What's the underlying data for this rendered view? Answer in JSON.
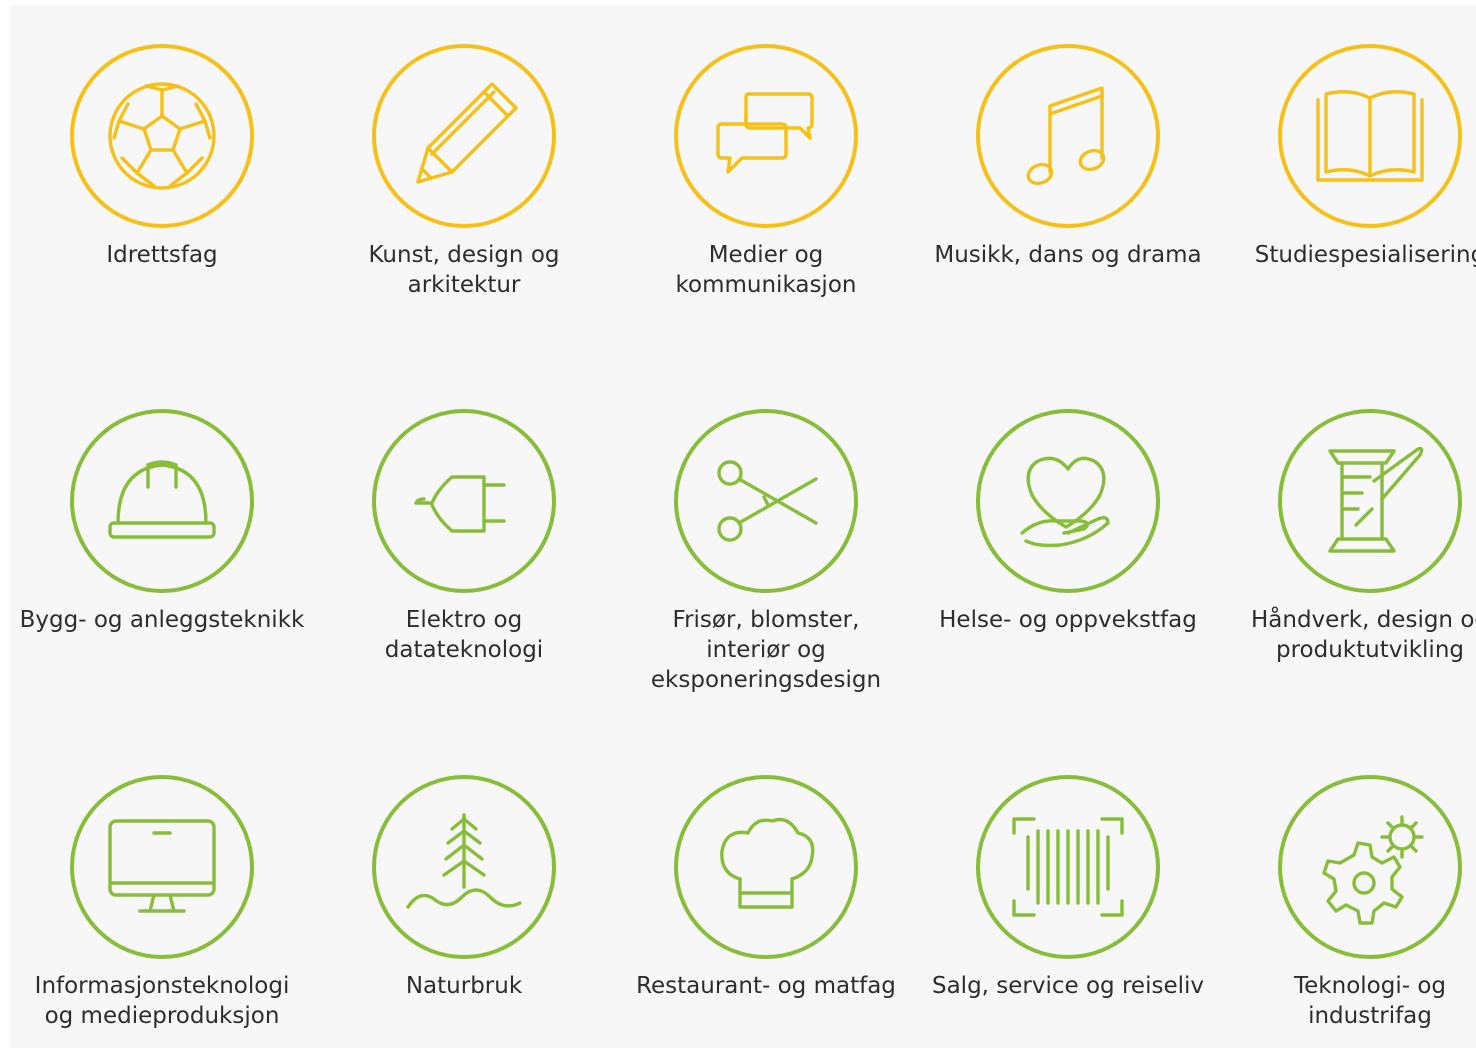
{
  "colors": {
    "row1_accent": "#f5c018",
    "rows23_accent": "#88bd3a",
    "label_text": "#2d2d2d",
    "background": "#f7f7f7"
  },
  "programs": [
    {
      "label": "Idrettsfag",
      "icon": "football-icon"
    },
    {
      "label": "Kunst, design og\narkitektur",
      "icon": "pencil-icon"
    },
    {
      "label": "Medier og\nkommunikasjon",
      "icon": "speech-bubbles-icon"
    },
    {
      "label": "Musikk, dans og drama",
      "icon": "music-note-icon"
    },
    {
      "label": "Studiespesialisering",
      "icon": "open-book-icon"
    },
    {
      "label": "Bygg- og anleggsteknikk",
      "icon": "hard-hat-icon"
    },
    {
      "label": "Elektro og\ndatateknologi",
      "icon": "electric-plug-icon"
    },
    {
      "label": "Frisør, blomster,\ninteriør og\neksponeringsdesign",
      "icon": "scissors-icon"
    },
    {
      "label": "Helse- og oppvekstfag",
      "icon": "heart-in-hand-icon"
    },
    {
      "label": "Håndverk, design og\nproduktutvikling",
      "icon": "thread-spool-icon"
    },
    {
      "label": "Informasjonsteknologi\nog medieproduksjon",
      "icon": "monitor-icon"
    },
    {
      "label": "Naturbruk",
      "icon": "tree-icon"
    },
    {
      "label": "Restaurant- og matfag",
      "icon": "chef-hat-icon"
    },
    {
      "label": "Salg, service og reiseliv",
      "icon": "barcode-icon"
    },
    {
      "label": "Teknologi- og\nindustrifag",
      "icon": "gears-icon"
    }
  ]
}
